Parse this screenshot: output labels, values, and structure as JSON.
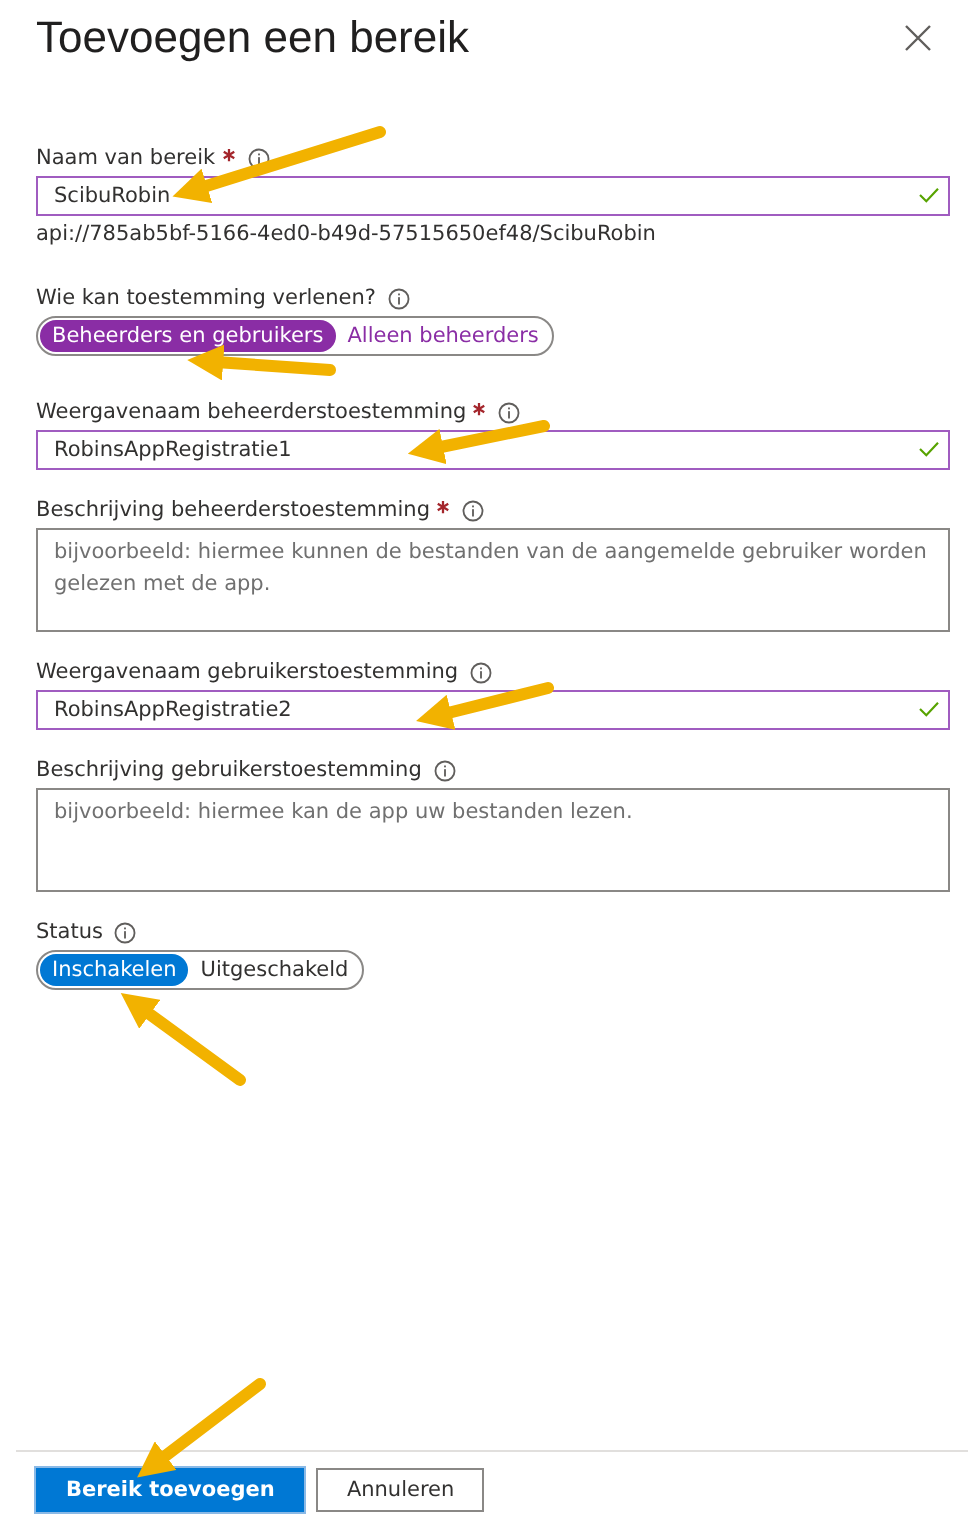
{
  "panel": {
    "title": "Toevoegen een bereik"
  },
  "fields": [
    {
      "kind": "text",
      "label": "Naam van bereik",
      "required": true,
      "value": "ScibuRobin",
      "valid": true,
      "hint": "api://785ab5bf-5166-4ed0-b49d-57515650ef48/ScibuRobin"
    },
    {
      "kind": "toggle",
      "label": "Wie kan toestemming verlenen?",
      "required": false,
      "color": "#8a2da5",
      "options": [
        {
          "label": "Beheerders en gebruikers",
          "selected": true
        },
        {
          "label": "Alleen beheerders",
          "selected": false
        }
      ]
    },
    {
      "kind": "text",
      "label": "Weergavenaam beheerderstoestemming",
      "required": true,
      "value": "RobinsAppRegistratie1",
      "valid": true
    },
    {
      "kind": "textarea",
      "label": "Beschrijving beheerderstoestemming",
      "required": true,
      "placeholder": "bijvoorbeeld: hiermee kunnen de bestanden van de aangemelde gebruiker worden gelezen met de app."
    },
    {
      "kind": "text",
      "label": "Weergavenaam gebruikerstoestemming",
      "required": false,
      "value": "RobinsAppRegistratie2",
      "valid": true
    },
    {
      "kind": "textarea",
      "label": "Beschrijving gebruikerstoestemming",
      "required": false,
      "placeholder": "bijvoorbeeld: hiermee kan de app uw bestanden lezen."
    },
    {
      "kind": "toggle",
      "label": "Status",
      "required": false,
      "color": "#0078d4",
      "options": [
        {
          "label": "Inschakelen",
          "selected": true
        },
        {
          "label": "Uitgeschakeld",
          "selected": false
        }
      ]
    }
  ],
  "buttons": [
    {
      "label": "Bereik toevoegen",
      "kind": "primary"
    },
    {
      "label": "Annuleren",
      "kind": "secondary"
    }
  ]
}
